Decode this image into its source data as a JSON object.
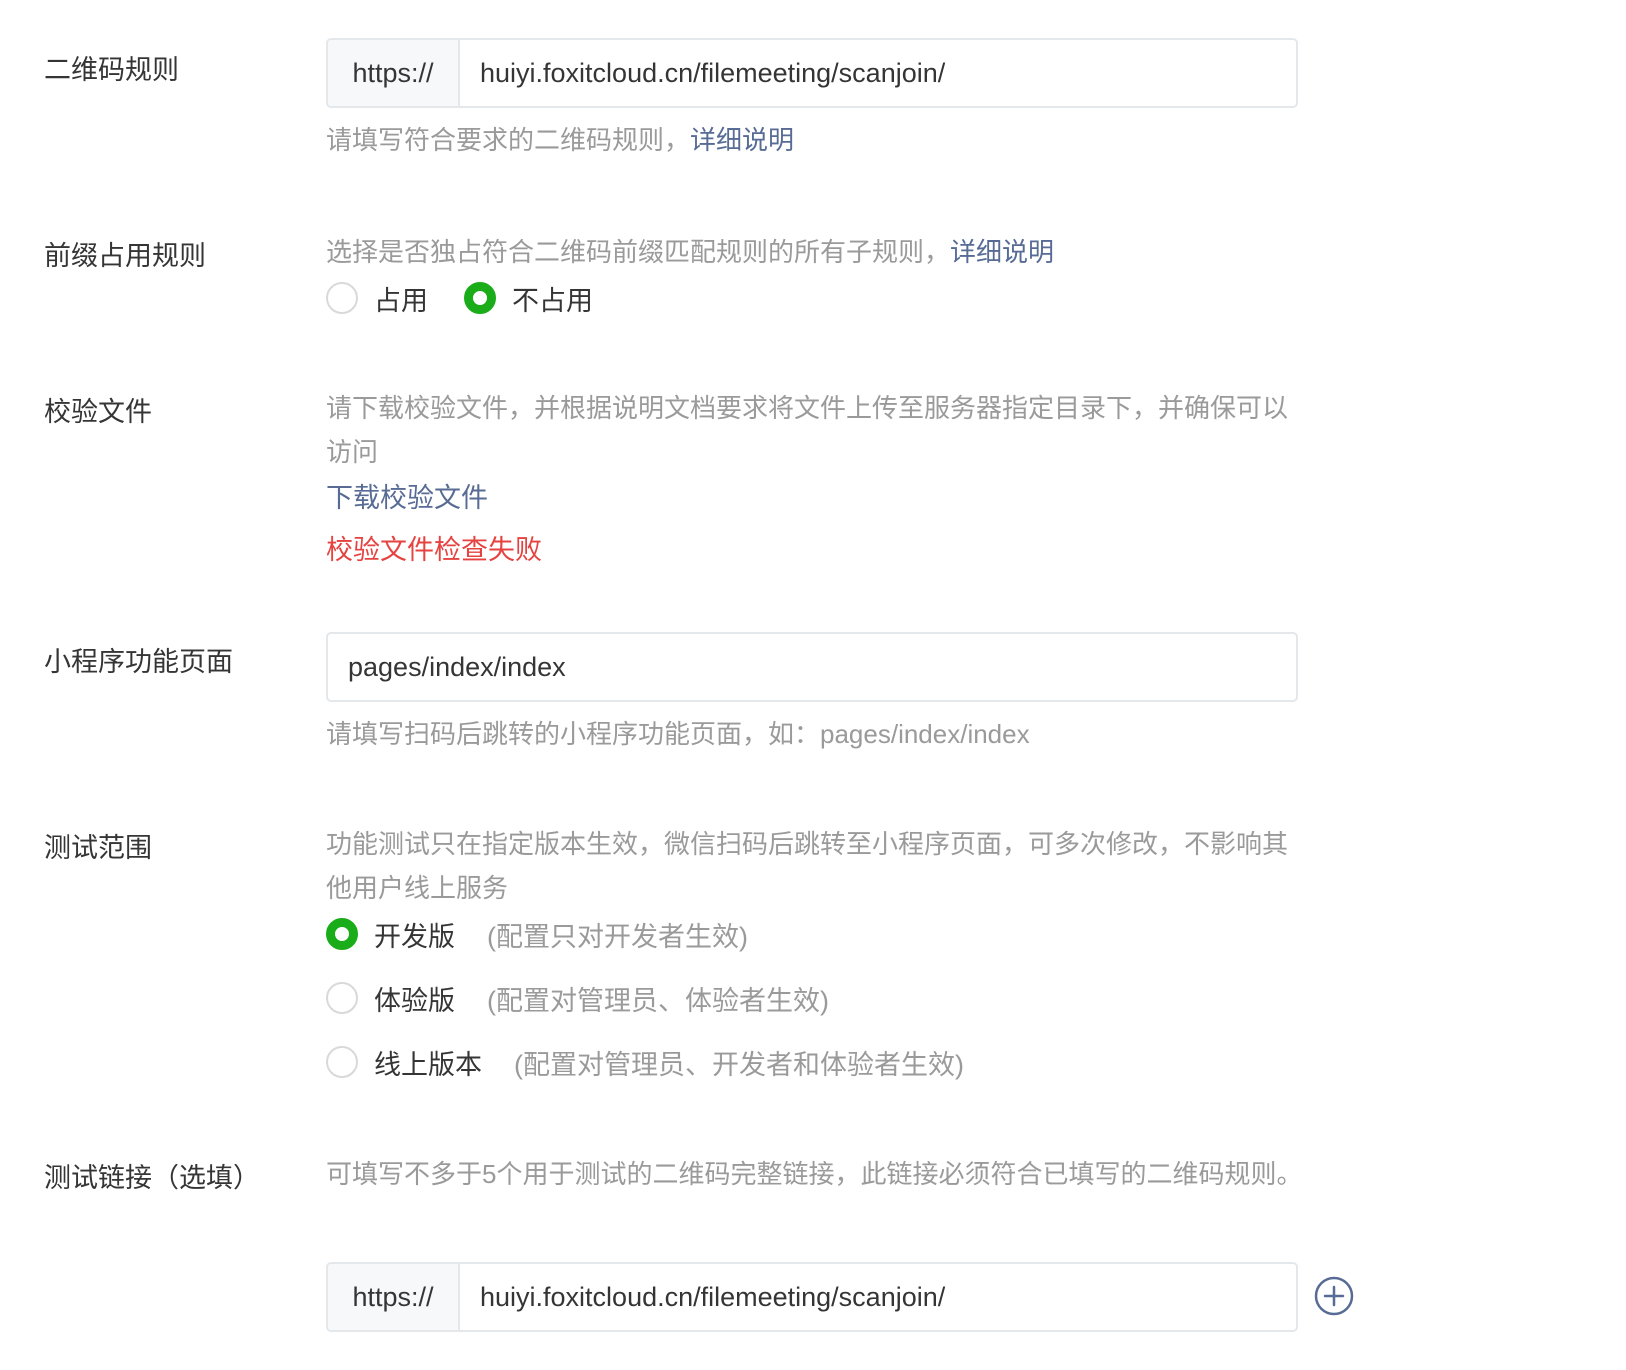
{
  "qr_rule": {
    "label": "二维码规则",
    "prefix": "https://",
    "value": "huiyi.foxitcloud.cn/filemeeting/scanjoin/",
    "tip": "请填写符合要求的二维码规则，",
    "tip_link": "详细说明"
  },
  "prefix_rule": {
    "label": "前缀占用规则",
    "tip": "选择是否独占符合二维码前缀匹配规则的所有子规则，",
    "tip_link": "详细说明",
    "options": [
      {
        "label": "占用",
        "checked": false
      },
      {
        "label": "不占用",
        "checked": true
      }
    ]
  },
  "verify_file": {
    "label": "校验文件",
    "tip": "请下载校验文件，并根据说明文档要求将文件上传至服务器指定目录下，并确保可以访问",
    "download_link": "下载校验文件",
    "error": "校验文件检查失败"
  },
  "page": {
    "label": "小程序功能页面",
    "value": "pages/index/index",
    "tip": "请填写扫码后跳转的小程序功能页面，如：pages/index/index"
  },
  "test_scope": {
    "label": "测试范围",
    "tip": "功能测试只在指定版本生效，微信扫码后跳转至小程序页面，可多次修改，不影响其他用户线上服务",
    "options": [
      {
        "label": "开发版",
        "desc": "(配置只对开发者生效)",
        "checked": true
      },
      {
        "label": "体验版",
        "desc": "(配置对管理员、体验者生效)",
        "checked": false
      },
      {
        "label": "线上版本",
        "desc": "(配置对管理员、开发者和体验者生效)",
        "checked": false
      }
    ]
  },
  "test_link": {
    "label": "测试链接（选填）",
    "tip": "可填写不多于5个用于测试的二维码完整链接，此链接必须符合已填写的二维码规则。",
    "prefix": "https://",
    "value": "huiyi.foxitcloud.cn/filemeeting/scanjoin/"
  },
  "colors": {
    "accent_green": "#1aad19",
    "link_blue": "#576b95",
    "error_red": "#e64340"
  }
}
